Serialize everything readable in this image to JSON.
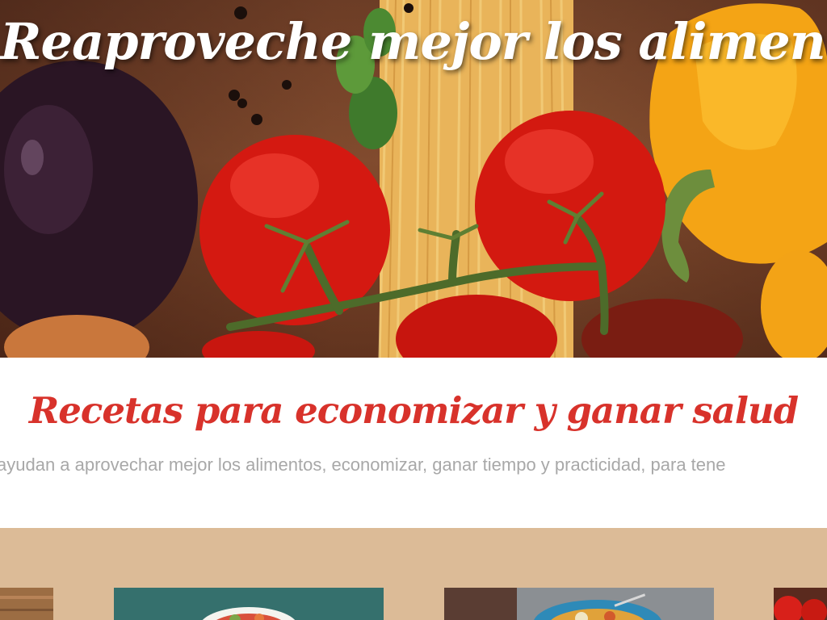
{
  "hero": {
    "title": "Reaproveche mejor los alimentos",
    "image_icon": "vegetables-photo"
  },
  "intro": {
    "title": "Recetas para economizar y ganar salud",
    "text": "ayudan a aprovechar mejor los alimentos, economizar, ganar tiempo y practicidad, para tene"
  },
  "colors": {
    "accent": "#d8322b",
    "band": "#dcbb97",
    "muted_text": "#a8a8a8"
  },
  "cards": [
    {
      "name": "recipe-card-1",
      "icon": "wood-photo"
    },
    {
      "name": "recipe-card-2",
      "icon": "salad-bowl-photo"
    },
    {
      "name": "recipe-card-3",
      "icon": "food-plate-photo"
    },
    {
      "name": "recipe-card-4",
      "icon": "tomatoes-photo"
    }
  ]
}
